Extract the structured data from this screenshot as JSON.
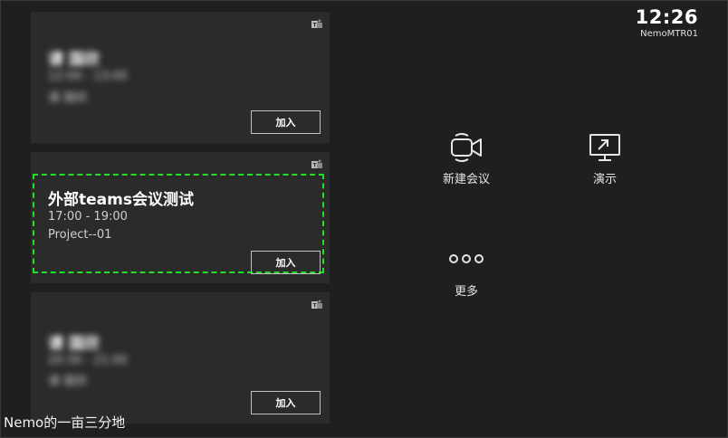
{
  "clock": {
    "time": "12:26",
    "device_name": "NemoMTR01"
  },
  "meetings": [
    {
      "title": "请 国欣",
      "time": "12:00 - 13:00",
      "room": "请 国欣",
      "join_label": "加入",
      "blurred": true
    },
    {
      "title": "外部teams会议测试",
      "time": "17:00 - 19:00",
      "room": "Project--01",
      "join_label": "加入",
      "focused": true
    },
    {
      "title": "请 国欣",
      "time": "20:30 - 21:00",
      "room": "请 国欣",
      "join_label": "加入",
      "blurred": true
    }
  ],
  "actions": {
    "new_meeting": {
      "label": "新建会议",
      "icon": "video-camera-icon"
    },
    "present": {
      "label": "演示",
      "icon": "screen-share-icon"
    },
    "more": {
      "label": "更多",
      "icon": "more-dots-icon"
    }
  },
  "watermark": "Nemo的一亩三分地",
  "colors": {
    "background": "#1f1f1f",
    "card": "#2b2b2b",
    "focus": "#22e022",
    "text": "#ffffff"
  }
}
